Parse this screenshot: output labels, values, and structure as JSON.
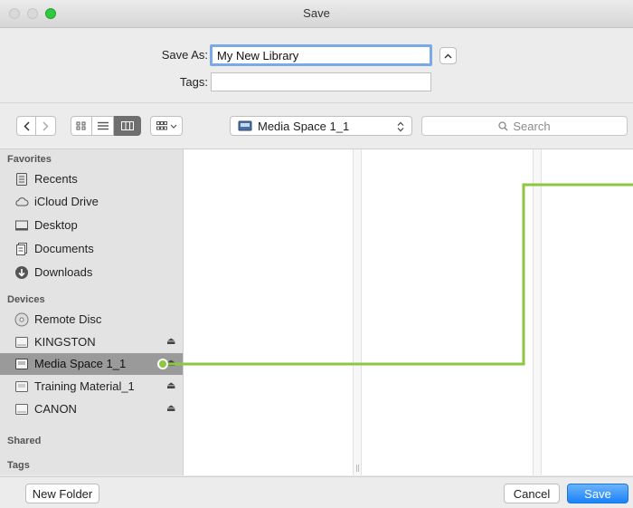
{
  "window": {
    "title": "Save"
  },
  "header": {
    "save_as_label": "Save As:",
    "save_as_value": "My New Library",
    "tags_label": "Tags:",
    "tags_value": "",
    "collapse_symbol": "^"
  },
  "toolbar": {
    "back_symbol": "<",
    "forward_symbol": ">",
    "location": "Media Space 1_1",
    "location_arrows": "⌃⌄",
    "search_placeholder": "Search",
    "view_modes": [
      "icon",
      "list",
      "column",
      "gallery"
    ],
    "selected_view": "column"
  },
  "sidebar": {
    "favorites_header": "Favorites",
    "favorites": [
      {
        "label": "Recents",
        "icon": "recents-icon"
      },
      {
        "label": "iCloud Drive",
        "icon": "icloud-icon"
      },
      {
        "label": "Desktop",
        "icon": "desktop-icon"
      },
      {
        "label": "Documents",
        "icon": "documents-icon"
      },
      {
        "label": "Downloads",
        "icon": "downloads-icon"
      }
    ],
    "devices_header": "Devices",
    "devices": [
      {
        "label": "Remote Disc",
        "icon": "disc-icon",
        "eject": false
      },
      {
        "label": "KINGSTON",
        "icon": "drive-icon",
        "eject": true
      },
      {
        "label": "Media Space 1_1",
        "icon": "drive-icon",
        "eject": true,
        "selected": true
      },
      {
        "label": "Training Material_1",
        "icon": "drive-icon",
        "eject": true
      },
      {
        "label": "CANON",
        "icon": "drive-icon",
        "eject": true
      }
    ],
    "shared_header": "Shared",
    "tags_header": "Tags",
    "eject_symbol": "⏏"
  },
  "footer": {
    "new_folder_label": "New Folder",
    "cancel_label": "Cancel",
    "save_label": "Save"
  },
  "colors": {
    "accent": "#1a82fb",
    "annotation": "#8dc63f",
    "sidebar_selected": "#9a9a9a"
  }
}
